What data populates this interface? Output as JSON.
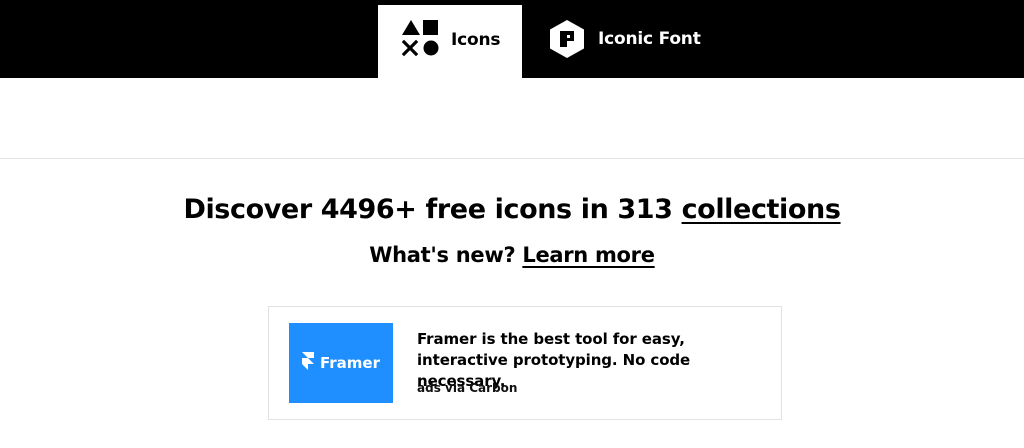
{
  "nav": {
    "tabs": [
      {
        "label": "Icons",
        "icon": "shapes-icon",
        "active": true
      },
      {
        "label": "Iconic Font",
        "icon": "iconic-font-logo-icon",
        "active": false
      }
    ]
  },
  "hero": {
    "headline_prefix": "Discover 4496+ free icons in 313 ",
    "headline_link": "collections",
    "whats_new": "What's new?",
    "learn_more": "Learn more"
  },
  "ad": {
    "brand": "Framer",
    "brand_color": "#1f8fff",
    "text": "Framer is the best tool for easy, interactive prototyping. No code necessary.",
    "via": "ads via Carbon"
  },
  "colors": {
    "topbar": "#000000",
    "active_tab": "#ffffff",
    "divider": "#e4e4e4"
  }
}
